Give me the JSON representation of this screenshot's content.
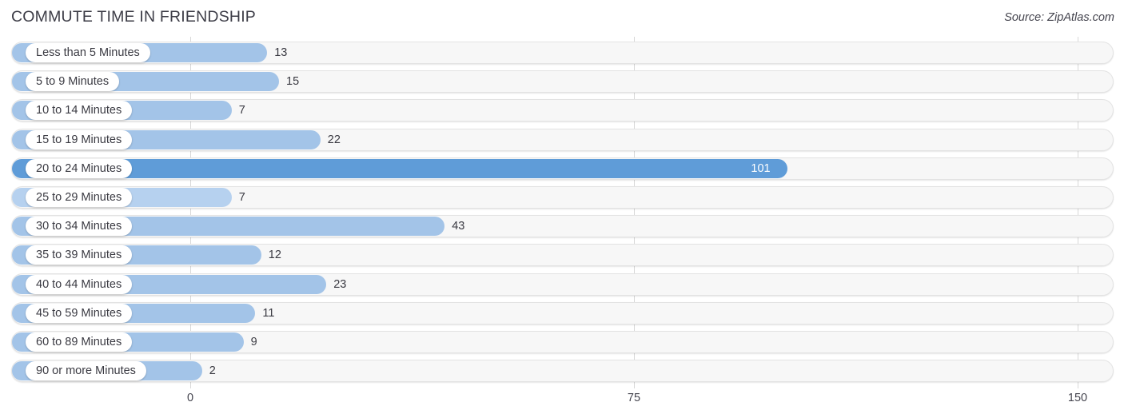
{
  "header": {
    "title": "COMMUTE TIME IN FRIENDSHIP",
    "source": "Source: ZipAtlas.com"
  },
  "colors": {
    "bar": "#a3c4e8",
    "bar_highlight": "#5f9cd8",
    "bar_muted": "#b6d1ef",
    "track": "#f7f7f7",
    "track_border": "#e3e3e3",
    "gridline": "#d8d8d8",
    "text": "#3a3a42",
    "value_inside_text": "#ffffff"
  },
  "chart_data": {
    "type": "bar",
    "orientation": "horizontal",
    "title": "COMMUTE TIME IN FRIENDSHIP",
    "xlabel": "",
    "ylabel": "",
    "xlim": [
      0,
      150
    ],
    "grid": true,
    "legend": "none",
    "ticks": [
      "0",
      "75",
      "150"
    ],
    "tick_values": [
      0,
      75,
      150
    ],
    "categories": [
      "Less than 5 Minutes",
      "5 to 9 Minutes",
      "10 to 14 Minutes",
      "15 to 19 Minutes",
      "20 to 24 Minutes",
      "25 to 29 Minutes",
      "30 to 34 Minutes",
      "35 to 39 Minutes",
      "40 to 44 Minutes",
      "45 to 59 Minutes",
      "60 to 89 Minutes",
      "90 or more Minutes"
    ],
    "values": [
      13,
      15,
      7,
      22,
      101,
      7,
      43,
      12,
      23,
      11,
      9,
      2
    ],
    "bars": [
      {
        "label": "Less than 5 Minutes",
        "value": 13,
        "value_text": "13",
        "style": "normal",
        "label_inside": true
      },
      {
        "label": "5 to 9 Minutes",
        "value": 15,
        "value_text": "15",
        "style": "normal",
        "label_inside": true
      },
      {
        "label": "10 to 14 Minutes",
        "value": 7,
        "value_text": "7",
        "style": "normal",
        "label_inside": true
      },
      {
        "label": "15 to 19 Minutes",
        "value": 22,
        "value_text": "22",
        "style": "normal",
        "label_inside": true
      },
      {
        "label": "20 to 24 Minutes",
        "value": 101,
        "value_text": "101",
        "style": "highlight",
        "label_inside": true
      },
      {
        "label": "25 to 29 Minutes",
        "value": 7,
        "value_text": "7",
        "style": "muted",
        "label_inside": true
      },
      {
        "label": "30 to 34 Minutes",
        "value": 43,
        "value_text": "43",
        "style": "normal",
        "label_inside": true
      },
      {
        "label": "35 to 39 Minutes",
        "value": 12,
        "value_text": "12",
        "style": "normal",
        "label_inside": true
      },
      {
        "label": "40 to 44 Minutes",
        "value": 23,
        "value_text": "23",
        "style": "normal",
        "label_inside": true
      },
      {
        "label": "45 to 59 Minutes",
        "value": 11,
        "value_text": "11",
        "style": "normal",
        "label_inside": true
      },
      {
        "label": "60 to 89 Minutes",
        "value": 9,
        "value_text": "9",
        "style": "normal",
        "label_inside": true
      },
      {
        "label": "90 or more Minutes",
        "value": 2,
        "value_text": "2",
        "style": "normal",
        "label_inside": true
      }
    ]
  }
}
